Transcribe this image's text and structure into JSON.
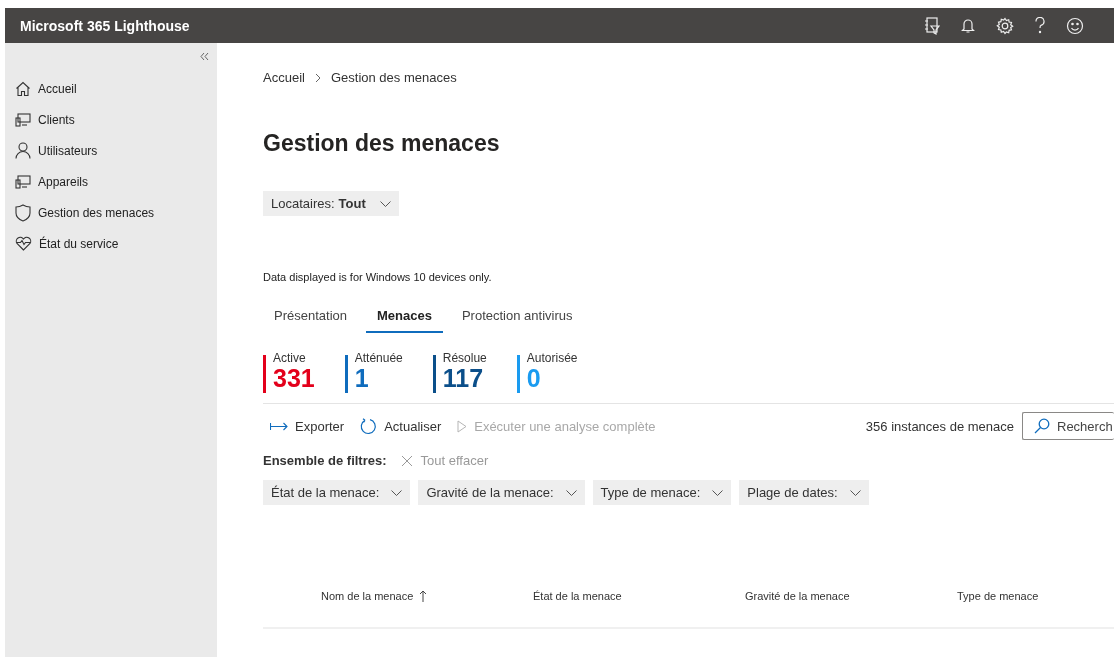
{
  "app_bar": {
    "title": "Microsoft 365 Lighthouse"
  },
  "sidebar": {
    "items": [
      {
        "label": "Accueil",
        "kind": "home",
        "selected": false
      },
      {
        "label": "Clients",
        "kind": "monitor",
        "selected": false
      },
      {
        "label": "Utilisateurs",
        "kind": "person",
        "selected": false
      },
      {
        "label": "Appareils",
        "kind": "monitor",
        "selected": false
      },
      {
        "label": "Gestion des menaces",
        "kind": "shield",
        "selected": false
      },
      {
        "label": "État du service",
        "kind": "heart",
        "selected": false
      }
    ]
  },
  "breadcrumb": [
    "Accueil",
    "Gestion des menaces"
  ],
  "page_title": "Gestion des menaces",
  "tenant_filter": {
    "label": "Locataires:",
    "value": "Tout"
  },
  "notice": "Data displayed is for Windows 10 devices only.",
  "tabs": [
    {
      "label": "Présentation",
      "selected": false
    },
    {
      "label": "Menaces",
      "selected": true
    },
    {
      "label": "Protection antivirus",
      "selected": false
    }
  ],
  "stats": [
    {
      "label": "Active",
      "value": "331",
      "color": "#e3001b"
    },
    {
      "label": "Atténuée",
      "value": "1",
      "color": "#0f6cbd"
    },
    {
      "label": "Résolue",
      "value": "117",
      "color": "#0b4f8a"
    },
    {
      "label": "Autorisée",
      "value": "0",
      "color": "#1a9bf0"
    }
  ],
  "toolbar": [
    {
      "label": "Exporter",
      "kind": "export",
      "disabled": false
    },
    {
      "label": "Actualiser",
      "kind": "refresh",
      "disabled": false
    },
    {
      "label": "Exécuter une analyse complète",
      "kind": "play",
      "disabled": true
    }
  ],
  "instance_count": "356 instances de menace",
  "search": {
    "placeholder": "Recherch"
  },
  "filter_set": {
    "label": "Ensemble de filtres:",
    "clear": "Tout effacer"
  },
  "filters": [
    "État de la menace:",
    "Gravité de la menace:",
    "Type de menace:",
    "Plage de dates:"
  ],
  "table": {
    "columns": [
      {
        "label": "Nom de la menace",
        "sorted": true
      },
      {
        "label": "État de la menace",
        "sorted": false
      },
      {
        "label": "Gravité de la menace",
        "sorted": false
      },
      {
        "label": "Type de menace",
        "sorted": false
      }
    ]
  }
}
